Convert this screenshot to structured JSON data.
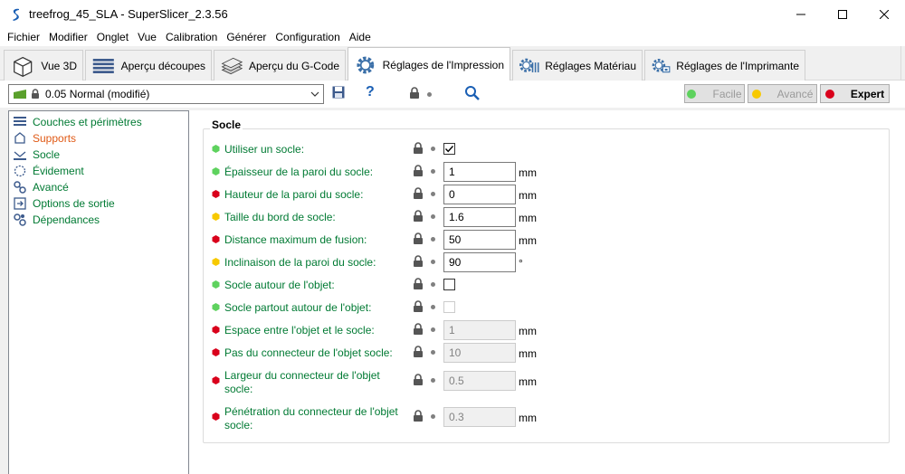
{
  "window": {
    "title": "treefrog_45_SLA - SuperSlicer_2.3.56"
  },
  "menu": [
    {
      "label": "Fichier"
    },
    {
      "label": "Modifier"
    },
    {
      "label": "Onglet"
    },
    {
      "label": "Vue"
    },
    {
      "label": "Calibration"
    },
    {
      "label": "Générer"
    },
    {
      "label": "Configuration"
    },
    {
      "label": "Aide"
    }
  ],
  "tabs": [
    {
      "label": "Vue 3D",
      "icon": "cube-icon"
    },
    {
      "label": "Aperçu découpes",
      "icon": "layers-icon"
    },
    {
      "label": "Aperçu du G-Code",
      "icon": "gcode-layers-icon"
    },
    {
      "label": "Réglages de l'Impression",
      "icon": "gear-icon",
      "active": true
    },
    {
      "label": "Réglages Matériau",
      "icon": "material-gear-icon"
    },
    {
      "label": "Réglages de l'Imprimante",
      "icon": "printer-gear-icon"
    }
  ],
  "toolbar": {
    "preset": "0.05 Normal (modifié)",
    "help_label": "?",
    "modes": [
      {
        "label": "Facile",
        "color": "#5ed25e",
        "enabled": false
      },
      {
        "label": "Avancé",
        "color": "#f7c900",
        "enabled": false
      },
      {
        "label": "Expert",
        "color": "#d9001b",
        "enabled": true
      }
    ]
  },
  "tree": [
    {
      "label": "Couches et périmètres",
      "icon": "layers-icon",
      "color": "green"
    },
    {
      "label": "Supports",
      "icon": "support-icon",
      "color": "red"
    },
    {
      "label": "Socle",
      "icon": "pad-icon",
      "color": "green",
      "selected": true
    },
    {
      "label": "Évidement",
      "icon": "hollow-icon",
      "color": "green"
    },
    {
      "label": "Avancé",
      "icon": "wrench-icon",
      "color": "green"
    },
    {
      "label": "Options de sortie",
      "icon": "output-icon",
      "color": "green"
    },
    {
      "label": "Dépendances",
      "icon": "dependencies-icon",
      "color": "green"
    }
  ],
  "settings": {
    "group_title": "Socle",
    "rows": [
      {
        "label": "Utiliser un socle:",
        "mode": "simple",
        "type": "checkbox",
        "checked": true,
        "enabled": true
      },
      {
        "label": "Épaisseur de la paroi du socle:",
        "mode": "simple",
        "type": "input",
        "value": "1",
        "unit": "mm",
        "enabled": true
      },
      {
        "label": "Hauteur de la paroi du socle:",
        "mode": "expert",
        "type": "input",
        "value": "0",
        "unit": "mm",
        "enabled": true
      },
      {
        "label": "Taille du bord de socle:",
        "mode": "advanced",
        "type": "input",
        "value": "1.6",
        "unit": "mm",
        "enabled": true
      },
      {
        "label": "Distance maximum de fusion:",
        "mode": "expert",
        "type": "input",
        "value": "50",
        "unit": "mm",
        "enabled": true
      },
      {
        "label": "Inclinaison de la paroi du socle:",
        "mode": "advanced",
        "type": "input",
        "value": "90",
        "unit": "°",
        "enabled": true
      },
      {
        "label": "Socle autour de l'objet:",
        "mode": "simple",
        "type": "checkbox",
        "checked": false,
        "enabled": true
      },
      {
        "label": "Socle partout autour de l'objet:",
        "mode": "simple",
        "type": "checkbox",
        "checked": false,
        "enabled": false
      },
      {
        "label": "Espace entre l'objet et le socle:",
        "mode": "expert",
        "type": "input",
        "value": "1",
        "unit": "mm",
        "enabled": false
      },
      {
        "label": "Pas du connecteur de l'objet socle:",
        "mode": "expert",
        "type": "input",
        "value": "10",
        "unit": "mm",
        "enabled": false
      },
      {
        "label": "Largeur du connecteur de l'objet socle:",
        "mode": "expert",
        "type": "input",
        "value": "0.5",
        "unit": "mm",
        "enabled": false
      },
      {
        "label": "Pénétration du connecteur de l'objet socle:",
        "mode": "expert",
        "type": "input",
        "value": "0.3",
        "unit": "mm",
        "enabled": false
      }
    ]
  },
  "colors": {
    "simple": "#5ed25e",
    "advanced": "#f7c900",
    "expert": "#d9001b",
    "label_green": "#007a33",
    "label_red": "#e05a16"
  }
}
